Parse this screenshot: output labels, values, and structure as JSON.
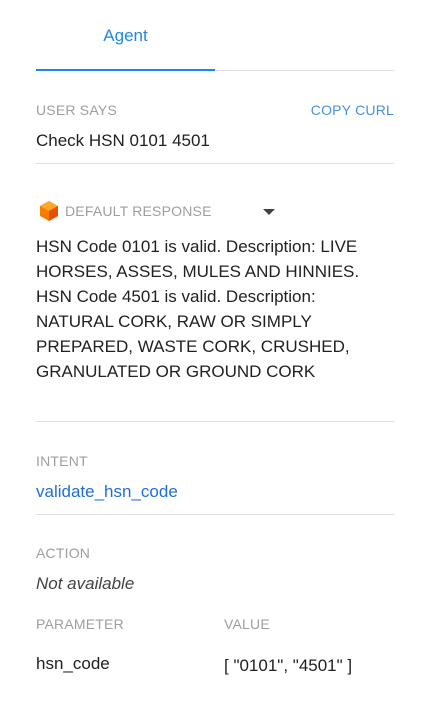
{
  "tabs": {
    "agent_label": "Agent"
  },
  "user_says": {
    "label": "USER SAYS",
    "copy_curl_label": "COPY CURL",
    "text": "Check HSN 0101 4501"
  },
  "default_response": {
    "icon": "cube-icon",
    "icon_color": "#f57c00",
    "label": "DEFAULT RESPONSE",
    "text": "HSN Code 0101 is valid. Description: LIVE HORSES, ASSES, MULES AND HINNIES. HSN Code 4501 is valid. Description: NATURAL CORK, RAW OR SIMPLY PREPARED, WASTE CORK, CRUSHED, GRANULATED OR GROUND CORK"
  },
  "intent": {
    "label": "INTENT",
    "value": "validate_hsn_code"
  },
  "action": {
    "label": "ACTION",
    "value": "Not available"
  },
  "parameters": {
    "param_header": "PARAMETER",
    "value_header": "VALUE",
    "rows": [
      {
        "name": "hsn_code",
        "value": "[ \"0101\", \"4501\" ]"
      }
    ]
  },
  "colors": {
    "accent": "#1e88e5",
    "link": "#1e6fd9",
    "muted": "#9e9e9e"
  }
}
